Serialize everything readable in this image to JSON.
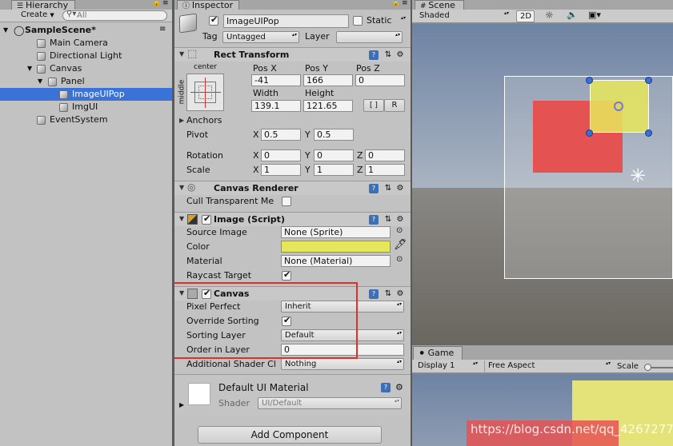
{
  "hierarchy": {
    "tab": "Hierarchy",
    "create": "Create",
    "search_placeholder": "All",
    "items": [
      {
        "label": "SampleScene*"
      },
      {
        "label": "Main Camera"
      },
      {
        "label": "Directional Light"
      },
      {
        "label": "Canvas"
      },
      {
        "label": "Panel"
      },
      {
        "label": "ImageUIPop"
      },
      {
        "label": "ImgUI"
      },
      {
        "label": "EventSystem"
      }
    ]
  },
  "inspector": {
    "tab": "Inspector",
    "object_name": "ImageUIPop",
    "static_label": "Static",
    "tag_label": "Tag",
    "tag_value": "Untagged",
    "layer_label": "Layer",
    "layer_value": "",
    "rect_transform": {
      "title": "Rect Transform",
      "anchor_top": "center",
      "anchor_side": "middle",
      "pos_x_label": "Pos X",
      "pos_y_label": "Pos Y",
      "pos_z_label": "Pos Z",
      "pos_x": "-41",
      "pos_y": "166",
      "pos_z": "0",
      "width_label": "Width",
      "height_label": "Height",
      "width": "139.1",
      "height": "121.65",
      "r_button": "R",
      "anchors_label": "Anchors",
      "pivot_label": "Pivot",
      "pivot_x": "0.5",
      "pivot_y": "0.5",
      "rotation_label": "Rotation",
      "rot_x": "0",
      "rot_y": "0",
      "rot_z": "0",
      "scale_label": "Scale",
      "scale_x": "1",
      "scale_y": "1",
      "scale_z": "1",
      "x": "X",
      "y": "Y",
      "z": "Z"
    },
    "canvas_renderer": {
      "title": "Canvas Renderer",
      "cull_label": "Cull Transparent Me"
    },
    "image_script": {
      "title": "Image (Script)",
      "source_label": "Source Image",
      "source_value": "None (Sprite)",
      "color_label": "Color",
      "color_value": "#e6e65a",
      "material_label": "Material",
      "material_value": "None (Material)",
      "raycast_label": "Raycast Target"
    },
    "canvas": {
      "title": "Canvas",
      "pixel_perfect_label": "Pixel Perfect",
      "pixel_perfect_value": "Inherit",
      "override_label": "Override Sorting",
      "sorting_layer_label": "Sorting Layer",
      "sorting_layer_value": "Default",
      "order_label": "Order in Layer",
      "order_value": "0",
      "shader_ch_label": "Additional Shader Cl",
      "shader_ch_value": "Nothing"
    },
    "material": {
      "title": "Default UI Material",
      "shader_label": "Shader",
      "shader_value": "UI/Default"
    },
    "add_component": "Add Component"
  },
  "scene": {
    "tab": "Scene",
    "shading": "Shaded",
    "mode_2d": "2D"
  },
  "game": {
    "tab": "Game",
    "display": "Display 1",
    "aspect": "Free Aspect",
    "scale_label": "Scale"
  },
  "watermark": "https://blog.csdn.net/qq_42672770"
}
